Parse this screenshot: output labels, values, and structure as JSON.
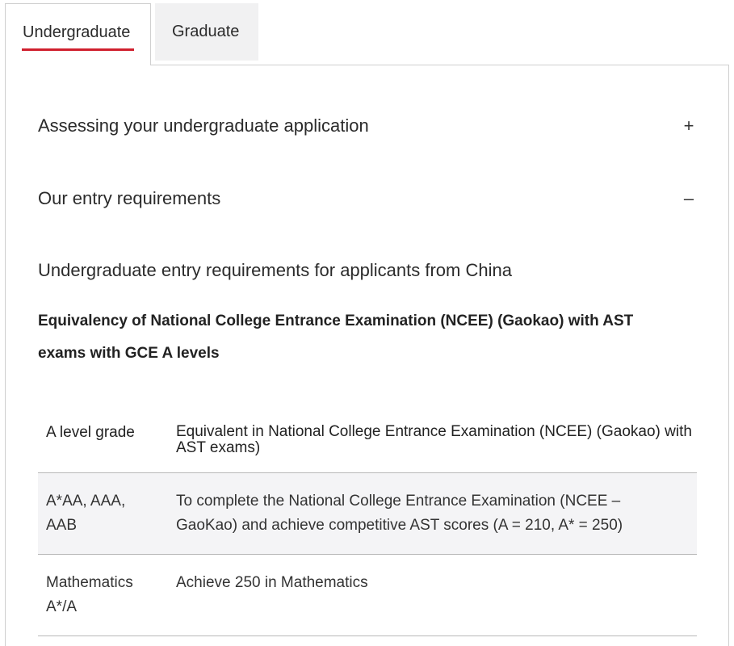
{
  "tabs": [
    {
      "label": "Undergraduate",
      "active": true
    },
    {
      "label": "Graduate",
      "active": false
    }
  ],
  "accordions": [
    {
      "title": "Assessing your undergraduate application",
      "icon": "plus-icon",
      "icon_glyph": "+",
      "expanded": false
    },
    {
      "title": "Our entry requirements",
      "icon": "minus-icon",
      "icon_glyph": "–",
      "expanded": true
    }
  ],
  "content": {
    "section_title": "Undergraduate entry requirements for applicants from China",
    "subtitle": "Equivalency of National College Entrance Examination (NCEE) (Gaokao) with AST exams with GCE A levels"
  },
  "table": {
    "headers": [
      "A level grade",
      "Equivalent in National College Entrance Examination (NCEE) (Gaokao) with AST exams)"
    ],
    "rows": [
      [
        "A*AA, AAA, AAB",
        "To complete the National College Entrance Examination (NCEE – GaoKao) and achieve competitive AST scores (A = 210, A* = 250)"
      ],
      [
        "Mathematics A*/A",
        "Achieve 250 in Mathematics"
      ]
    ]
  },
  "colors": {
    "accent": "#d0202e",
    "inactive_tab_bg": "#f1f1f2",
    "shaded_row_bg": "#f4f4f6",
    "border": "#cfcfcf"
  }
}
